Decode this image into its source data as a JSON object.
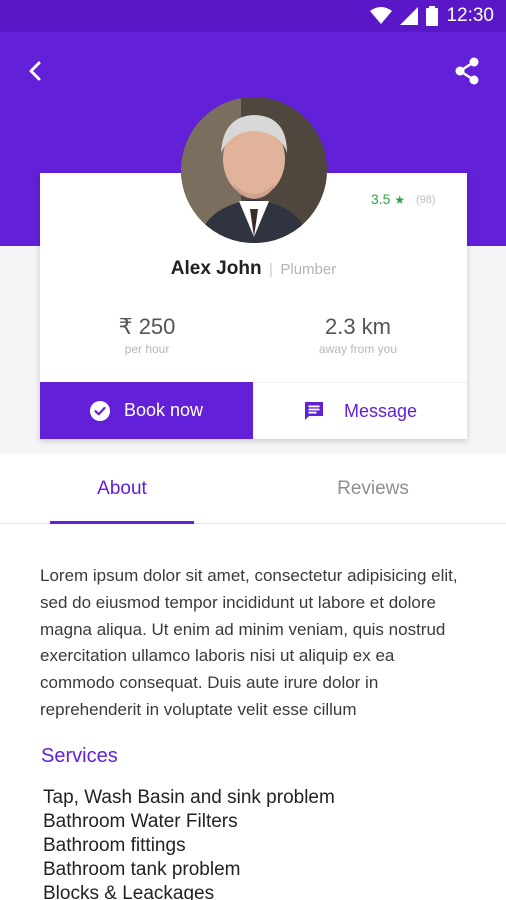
{
  "status_bar": {
    "time": "12:30"
  },
  "profile": {
    "name": "Alex John",
    "separator": "|",
    "role": "Plumber",
    "rating": "3.5",
    "rating_star": "★",
    "rating_count": "(98)"
  },
  "stats": [
    {
      "value": "₹ 250",
      "label": "per hour"
    },
    {
      "value": "2.3 km",
      "label": "away from you"
    }
  ],
  "actions": {
    "book_label": "Book now",
    "message_label": "Message"
  },
  "tabs": [
    {
      "label": "About",
      "active": true
    },
    {
      "label": "Reviews",
      "active": false
    }
  ],
  "about": {
    "text": "Lorem ipsum dolor sit amet, consectetur adipisicing elit, sed do eiusmod tempor incididunt ut labore et dolore magna aliqua. Ut enim ad minim veniam, quis nostrud exercitation ullamco laboris nisi ut aliquip ex ea commodo consequat. Duis aute irure dolor in reprehenderit in voluptate velit esse cillum"
  },
  "services": {
    "title": "Services",
    "items": [
      "Tap, Wash Basin and sink problem",
      "Bathroom Water Filters",
      "Bathroom fittings",
      "Bathroom tank problem",
      "Blocks & Leackages"
    ]
  },
  "colors": {
    "primary": "#6220d9",
    "status_bar": "#5a17c8",
    "rating": "#2fa44f"
  },
  "icons": [
    "wifi-icon",
    "signal-icon",
    "battery-icon",
    "back-arrow-icon",
    "share-icon",
    "check-circle-icon",
    "message-icon"
  ]
}
